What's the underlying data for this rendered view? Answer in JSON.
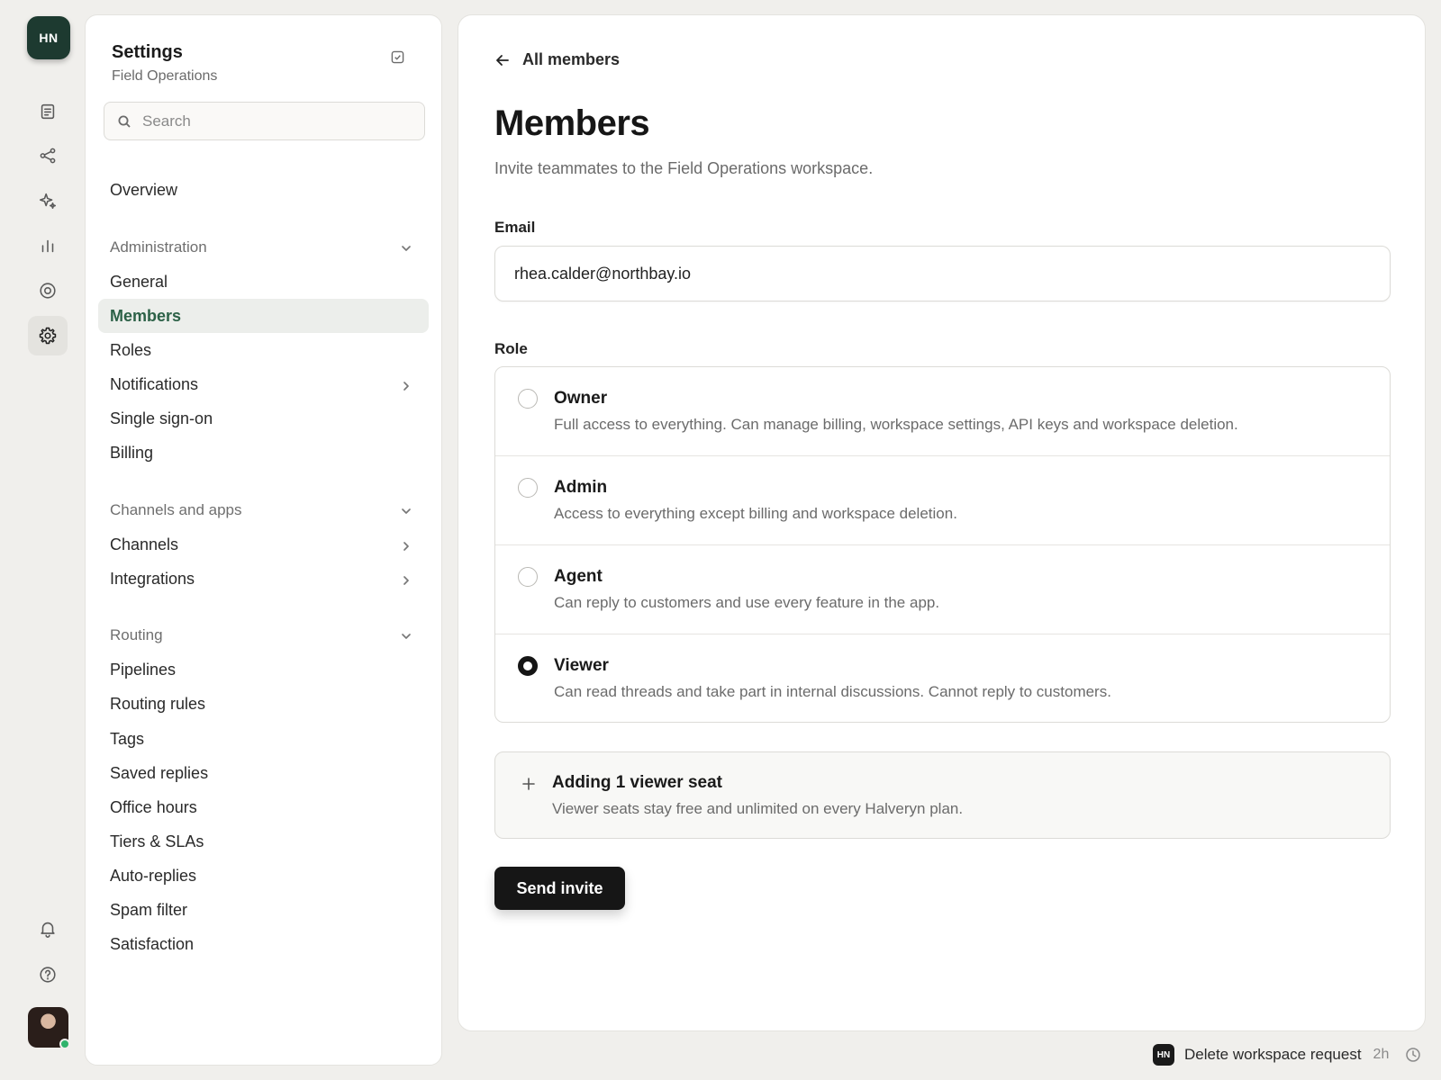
{
  "workspace": {
    "initials": "HN"
  },
  "rail": {
    "icons": [
      "document-icon",
      "share-icon",
      "sparkle-icon",
      "bar-chart-icon",
      "target-icon",
      "gear-icon",
      "bell-icon",
      "help-icon"
    ],
    "active": "gear-icon"
  },
  "settings": {
    "title": "Settings",
    "subtitle": "Field Operations",
    "search_placeholder": "Search",
    "overview": "Overview",
    "administration": {
      "label": "Administration",
      "items": [
        "General",
        "Members",
        "Roles",
        "Notifications",
        "Single sign-on",
        "Billing"
      ]
    },
    "channels": {
      "label": "Channels and apps",
      "items": [
        "Channels",
        "Integrations"
      ]
    },
    "routing": {
      "label": "Routing",
      "items": [
        "Pipelines",
        "Routing rules",
        "Tags",
        "Saved replies",
        "Office hours",
        "Tiers & SLAs",
        "Auto-replies",
        "Spam filter",
        "Satisfaction"
      ]
    },
    "active_item": "Members"
  },
  "main": {
    "back_label": "All members",
    "title": "Members",
    "description": "Invite teammates to the Field Operations workspace.",
    "email_label": "Email",
    "email_value": "rhea.calder@northbay.io",
    "role_label": "Role",
    "roles": [
      {
        "name": "Owner",
        "desc": "Full access to everything. Can manage billing, workspace settings, API keys and workspace deletion."
      },
      {
        "name": "Admin",
        "desc": "Access to everything except billing and workspace deletion."
      },
      {
        "name": "Agent",
        "desc": "Can reply to customers and use every feature in the app."
      },
      {
        "name": "Viewer",
        "desc": "Can read threads and take part in internal discussions. Cannot reply to customers."
      }
    ],
    "selected_role": "Viewer",
    "seat_title": "Adding 1 viewer seat",
    "seat_desc": "Viewer seats stay free and unlimited on every Halveryn plan.",
    "send_label": "Send invite"
  },
  "toast": {
    "badge": "HN",
    "text": "Delete workspace request",
    "time": "2h"
  },
  "colors": {
    "accent_green": "#2c6147",
    "logo_bg": "#1d3a30",
    "button_dark": "#161616",
    "online_dot": "#2fb36b"
  }
}
